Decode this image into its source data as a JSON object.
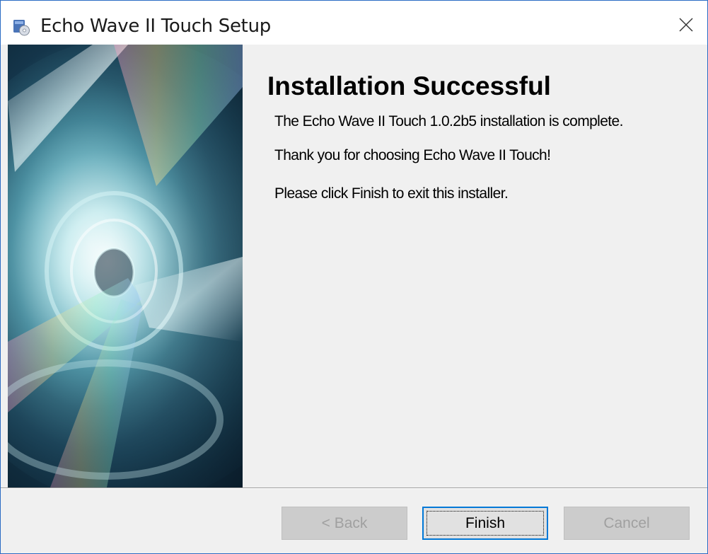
{
  "window": {
    "title": "Echo Wave II Touch Setup"
  },
  "main": {
    "heading": "Installation Successful",
    "paragraphs": [
      "The Echo Wave II Touch 1.0.2b5 installation is complete.",
      "Thank you for choosing Echo Wave II Touch!",
      "Please click Finish to exit this installer."
    ]
  },
  "footer": {
    "back_label": "< Back",
    "finish_label": "Finish",
    "cancel_label": "Cancel"
  },
  "icons": {
    "app": "installer-cd-icon",
    "close": "close-icon"
  },
  "colors": {
    "accent": "#0078d7",
    "window_border": "#2b6cc4",
    "dialog_bg": "#f0f0f0"
  }
}
